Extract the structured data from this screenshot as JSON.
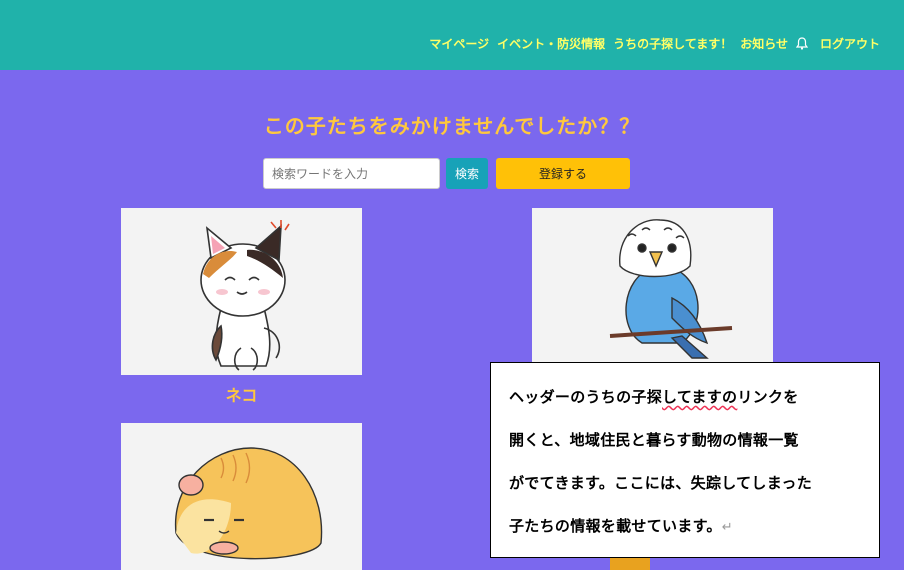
{
  "header": {
    "nav": [
      "マイページ",
      "イベント・防災情報",
      "うちの子探してます！",
      "お知らせ"
    ],
    "bell_icon": "bell-icon",
    "logout": "ログアウト",
    "bg_color": "#20b2aa",
    "link_color": "#ffff66"
  },
  "main": {
    "title": "この子たちをみかけませんでしたか？？",
    "search": {
      "placeholder": "検索ワードを入力",
      "value": ""
    },
    "search_button": "検索",
    "register_button": "登録する",
    "bg_color": "#7b68ee"
  },
  "animals": [
    {
      "name": "ネコ",
      "image": "calico-cat-illustration"
    },
    {
      "image": "budgerigar-illustration"
    },
    {
      "image": "hamster-illustration"
    }
  ],
  "note": {
    "line1_a": "ヘッダーのうちの子探",
    "line1_b": "してますの",
    "line1_c": "リンクを",
    "line2": "開くと、地域住民と暮らす動物の情報一覧",
    "line3": "がでてきます。ここには、失踪してしまった",
    "line4": "子たちの情報を載せています。",
    "return_mark": "↵"
  }
}
